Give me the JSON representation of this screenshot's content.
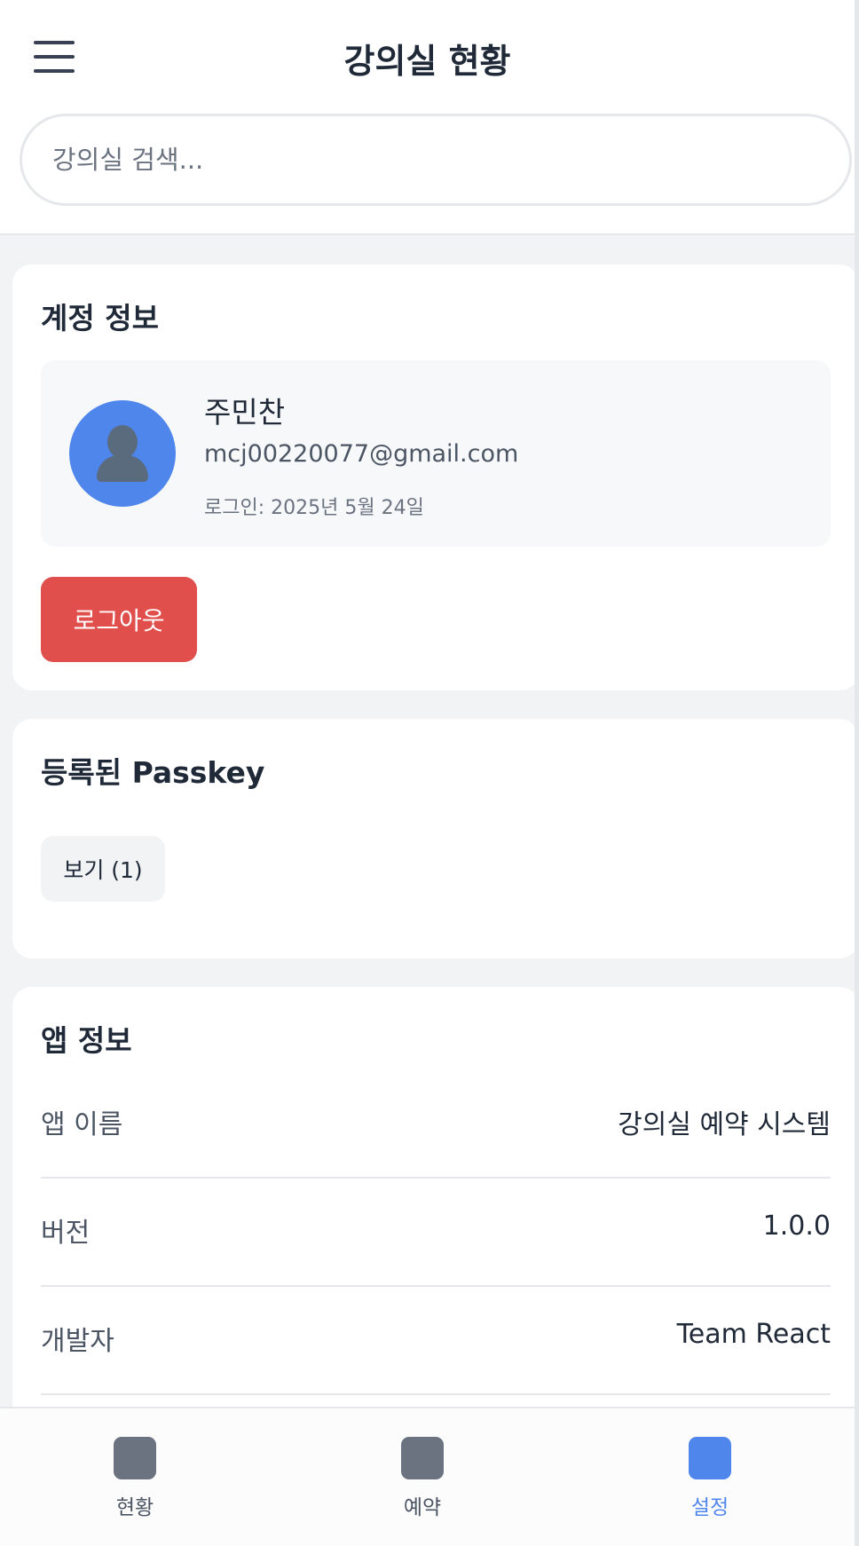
{
  "header": {
    "title": "강의실 현황",
    "search_placeholder": "강의실 검색..."
  },
  "account": {
    "section_title": "계정 정보",
    "name": "주민찬",
    "email": "mcj00220077@gmail.com",
    "login_text": "로그인: 2025년 5월 24일",
    "logout_label": "로그아웃"
  },
  "passkey": {
    "section_title": "등록된 Passkey",
    "view_label": "보기 (1)"
  },
  "app_info": {
    "section_title": "앱 정보",
    "rows": [
      {
        "label": "앱 이름",
        "value": "강의실 예약 시스템"
      },
      {
        "label": "버전",
        "value": "1.0.0"
      },
      {
        "label": "개발자",
        "value": "Team React"
      }
    ]
  },
  "bottom_nav": {
    "items": [
      {
        "label": "현황",
        "icon": "status-icon",
        "active": false
      },
      {
        "label": "예약",
        "icon": "reservation-icon",
        "active": false
      },
      {
        "label": "설정",
        "icon": "settings-icon",
        "active": true
      }
    ]
  },
  "colors": {
    "accent": "#4f86ec",
    "logout": "#e04f4c",
    "inactive_icon": "#6b7280"
  }
}
